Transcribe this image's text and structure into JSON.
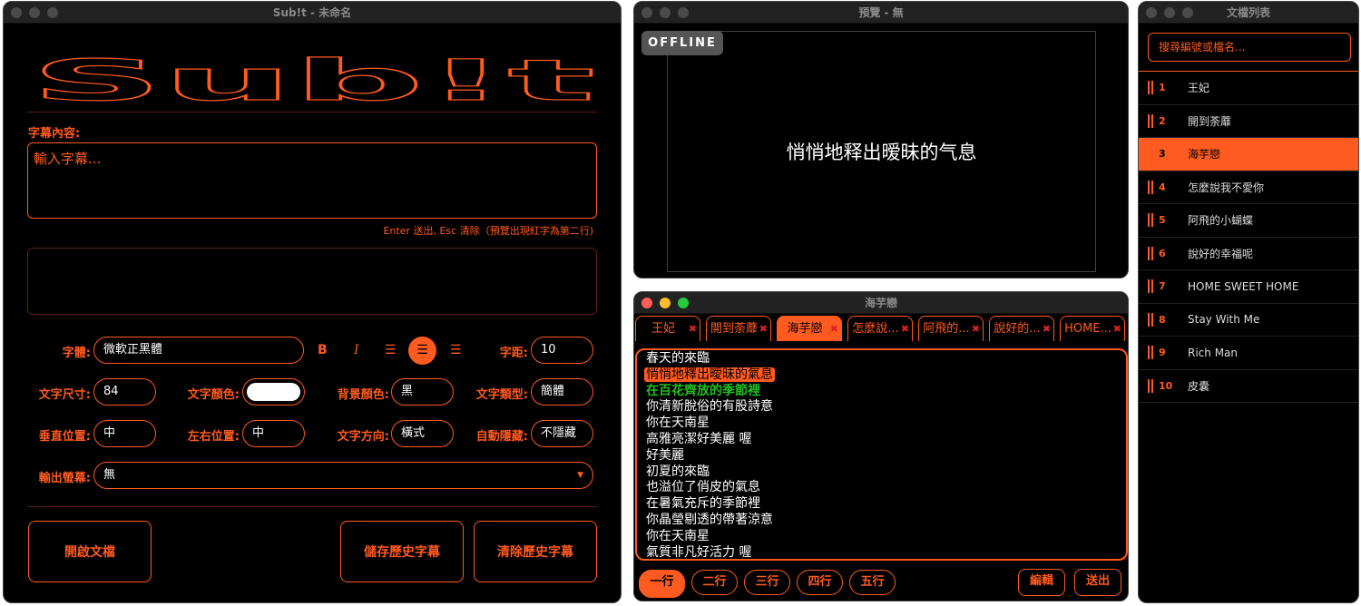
{
  "main": {
    "title": "Sub!t - 未命名",
    "logo": "Sub!t",
    "content_label": "字幕內容:",
    "input_placeholder": "輸入字幕...",
    "hint": "Enter 送出, Esc 清除（預覽出現紅字為第二行)",
    "font_label": "字體:",
    "font_value": "微軟正黑體",
    "bold": "B",
    "italic": "I",
    "spacing_label": "字距:",
    "spacing_value": "10",
    "size_label": "文字尺寸:",
    "size_value": "84",
    "color_label": "文字顏色:",
    "text_color": "#ffffff",
    "bg_label": "背景顏色:",
    "bg_value": "黑",
    "type_label": "文字類型:",
    "type_value": "簡體",
    "vpos_label": "垂直位置:",
    "vpos_value": "中",
    "hpos_label": "左右位置:",
    "hpos_value": "中",
    "dir_label": "文字方向:",
    "dir_value": "橫式",
    "autohide_label": "自動隱藏:",
    "autohide_value": "不隱藏",
    "output_label": "輸出螢幕:",
    "output_value": "無",
    "open_btn": "開啟文檔",
    "save_btn": "儲存歷史字幕",
    "clear_btn": "清除歷史字幕"
  },
  "preview": {
    "title": "預覽 - 無",
    "status": "OFFLINE",
    "text": "悄悄地释出暧昧的气息"
  },
  "song": {
    "title": "海芋戀",
    "tabs": [
      "王妃",
      "開到荼蘼",
      "海芋戀",
      "怎麼說...",
      "阿飛的...",
      "說好的...",
      "HOME..."
    ],
    "active_tab": 2,
    "lines": [
      "春天的來臨",
      "悄悄地釋出曖昧的氣息",
      "在百花齊放的季節裡",
      "你清新脫俗的有股詩意",
      "你在天南星",
      "高雅亮潔好美麗 喔",
      "好美麗",
      "初夏的來臨",
      "也溢位了俏皮的氣息",
      "在暑氣充斥的季節裡",
      "你晶瑩剔透的帶著涼意",
      "你在天南星",
      "氣質非凡好活力 喔"
    ],
    "current_line": 1,
    "next_line": 2,
    "line_buttons": [
      "一行",
      "二行",
      "三行",
      "四行",
      "五行"
    ],
    "edit": "編輯",
    "send": "送出"
  },
  "list": {
    "title": "文檔列表",
    "search_placeholder": "搜尋編號或檔名...",
    "items": [
      {
        "n": "1",
        "name": "王妃"
      },
      {
        "n": "2",
        "name": "開到荼蘼"
      },
      {
        "n": "3",
        "name": "海芋戀"
      },
      {
        "n": "4",
        "name": "怎麼說我不愛你"
      },
      {
        "n": "5",
        "name": "阿飛的小蝴蝶"
      },
      {
        "n": "6",
        "name": "說好的幸福呢"
      },
      {
        "n": "7",
        "name": "HOME SWEET HOME"
      },
      {
        "n": "8",
        "name": "Stay With Me"
      },
      {
        "n": "9",
        "name": "Rich Man"
      },
      {
        "n": "10",
        "name": "皮囊"
      }
    ],
    "active": 2
  },
  "colors": {
    "accent": "#ff5a1f",
    "green": "#1fbf1f"
  }
}
